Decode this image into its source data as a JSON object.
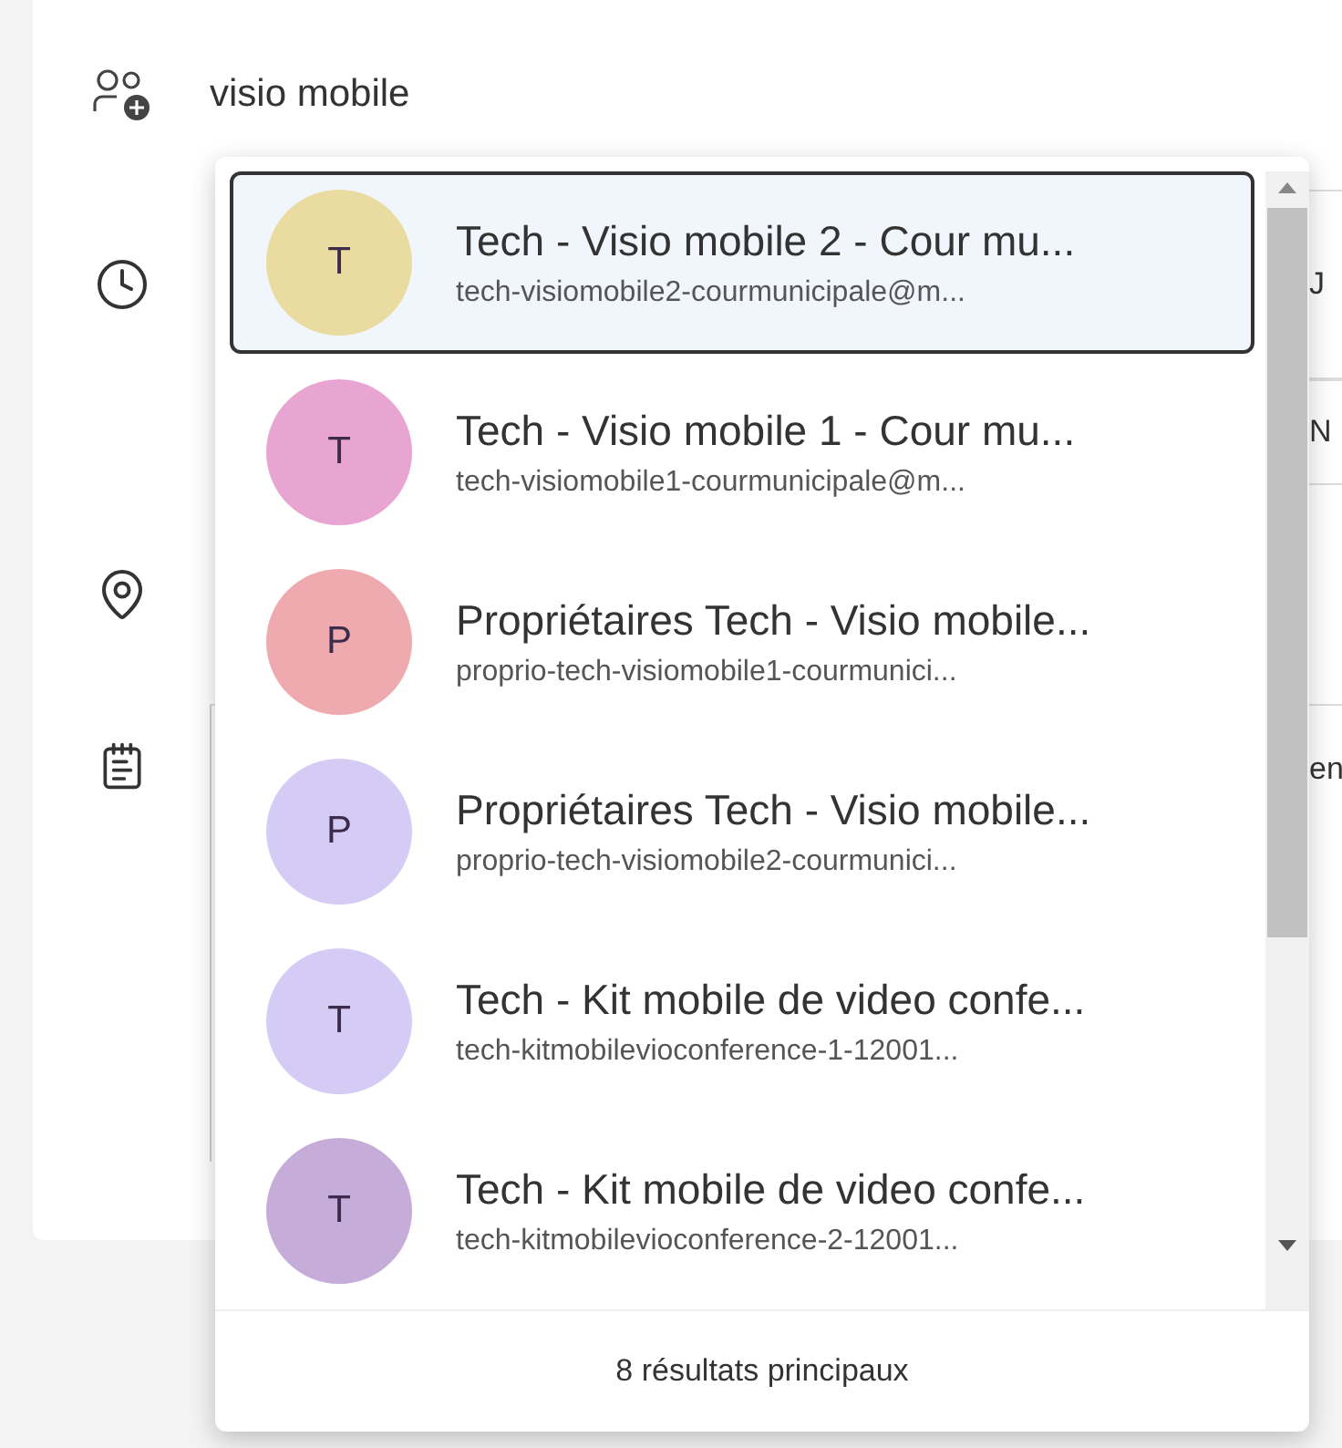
{
  "attendees_field": {
    "value": "visio mobile"
  },
  "background_fields": [
    "J",
    "N",
    "en"
  ],
  "suggestions": [
    {
      "initial": "T",
      "name": "Tech - Visio mobile 2 - Cour mu...",
      "email": "tech-visiomobile2-courmunicipale@m...",
      "color": "#eadca0",
      "selected": true
    },
    {
      "initial": "T",
      "name": "Tech - Visio mobile 1 - Cour mu...",
      "email": "tech-visiomobile1-courmunicipale@m...",
      "color": "#e9a5d1",
      "selected": false
    },
    {
      "initial": "P",
      "name": "Propriétaires Tech - Visio mobile...",
      "email": "proprio-tech-visiomobile1-courmunici...",
      "color": "#eeaaae",
      "selected": false
    },
    {
      "initial": "P",
      "name": "Propriétaires Tech - Visio mobile...",
      "email": "proprio-tech-visiomobile2-courmunici...",
      "color": "#d4ccf5",
      "selected": false
    },
    {
      "initial": "T",
      "name": "Tech - Kit mobile de video confe...",
      "email": "tech-kitmobilevioconference-1-12001...",
      "color": "#d4ccf5",
      "selected": false
    },
    {
      "initial": "T",
      "name": "Tech - Kit mobile de video confe...",
      "email": "tech-kitmobilevioconference-2-12001...",
      "color": "#c5acd9",
      "selected": false
    }
  ],
  "results_footer": "8 résultats principaux"
}
